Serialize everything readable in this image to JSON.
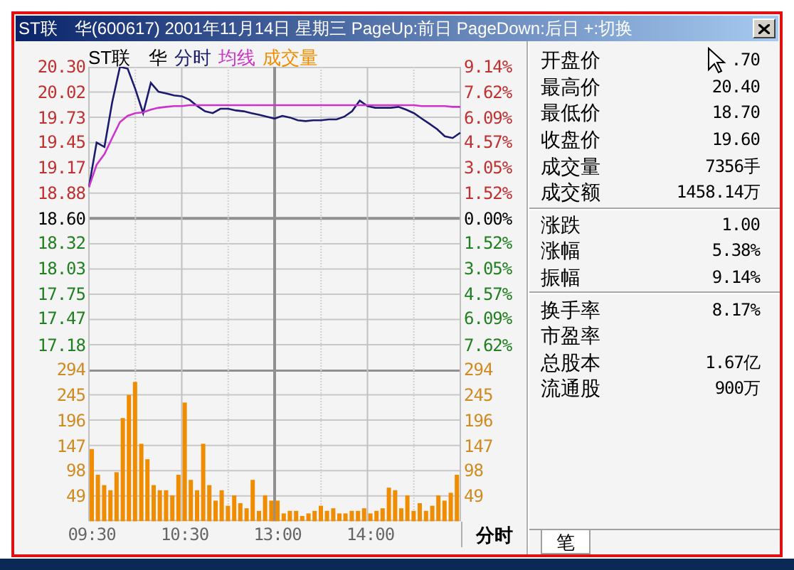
{
  "window": {
    "title": "ST联　华(600617) 2001年11月14日 星期三 PageUp:前日 PageDown:后日 +:切换"
  },
  "stock_name": "ST联　华",
  "price_chart": {
    "chart_data": {
      "type": "line",
      "categories": [
        null,
        null,
        null,
        null,
        null,
        null,
        null,
        null,
        null,
        null,
        null,
        null,
        null,
        null,
        null,
        null,
        null,
        null,
        null,
        null,
        null,
        null,
        null,
        null,
        null,
        null,
        null,
        null,
        null,
        null,
        null,
        null,
        null,
        null,
        null,
        null,
        null,
        null,
        null,
        null,
        null,
        null,
        null,
        null,
        null,
        null,
        null,
        null,
        null
      ],
      "series": [
        {
          "name": "分时",
          "color": "#1a1a6e",
          "values": [
            18.95,
            19.45,
            19.4,
            19.9,
            20.3,
            20.28,
            20.05,
            19.78,
            20.12,
            20.02,
            20.0,
            19.98,
            19.97,
            19.93,
            19.86,
            19.8,
            19.78,
            19.83,
            19.83,
            19.81,
            19.8,
            19.78,
            19.76,
            19.74,
            19.72,
            19.75,
            19.73,
            19.7,
            19.69,
            19.7,
            19.7,
            19.71,
            19.71,
            19.74,
            19.8,
            19.92,
            19.86,
            19.84,
            19.84,
            19.84,
            19.85,
            19.82,
            19.78,
            19.72,
            19.66,
            19.6,
            19.52,
            19.5,
            19.56
          ]
        },
        {
          "name": "均线",
          "color": "#cc33cc",
          "values": [
            18.95,
            19.2,
            19.32,
            19.5,
            19.68,
            19.75,
            19.78,
            19.79,
            19.82,
            19.84,
            19.85,
            19.86,
            19.86,
            19.87,
            19.87,
            19.87,
            19.87,
            19.87,
            19.87,
            19.87,
            19.87,
            19.87,
            19.87,
            19.87,
            19.87,
            19.87,
            19.87,
            19.87,
            19.87,
            19.87,
            19.87,
            19.87,
            19.87,
            19.87,
            19.87,
            19.87,
            19.87,
            19.87,
            19.87,
            19.87,
            19.87,
            19.87,
            19.87,
            19.86,
            19.86,
            19.86,
            19.86,
            19.85,
            19.85
          ]
        }
      ],
      "ylim": [
        17.18,
        20.3
      ],
      "grid": true,
      "yticks": [
        {
          "value": 20.3,
          "label": "20.30"
        },
        {
          "value": 20.02,
          "label": "20.02"
        },
        {
          "value": 19.73,
          "label": "19.73"
        },
        {
          "value": 19.45,
          "label": "19.45"
        },
        {
          "value": 19.17,
          "label": "19.17"
        },
        {
          "value": 18.88,
          "label": "18.88"
        },
        {
          "value": 18.6,
          "label": "18.60"
        },
        {
          "value": 18.32,
          "label": "18.32"
        },
        {
          "value": 18.03,
          "label": "18.03"
        },
        {
          "value": 17.75,
          "label": "17.75"
        },
        {
          "value": 17.47,
          "label": "17.47"
        },
        {
          "value": 17.18,
          "label": "17.18"
        }
      ]
    },
    "right_axis": [
      {
        "label": "9.14%",
        "kind": "up"
      },
      {
        "label": "7.62%",
        "kind": "up"
      },
      {
        "label": "6.09%",
        "kind": "up"
      },
      {
        "label": "4.57%",
        "kind": "up"
      },
      {
        "label": "3.05%",
        "kind": "up"
      },
      {
        "label": "1.52%",
        "kind": "up"
      },
      {
        "label": "0.00%",
        "kind": "flat"
      },
      {
        "label": "1.52%",
        "kind": "down"
      },
      {
        "label": "3.05%",
        "kind": "down"
      },
      {
        "label": "4.57%",
        "kind": "down"
      },
      {
        "label": "6.09%",
        "kind": "down"
      },
      {
        "label": "7.62%",
        "kind": "down"
      }
    ]
  },
  "volume_chart": {
    "chart_data": {
      "type": "bar",
      "categories": [
        "09:30",
        null,
        null,
        null,
        null,
        null,
        null,
        null,
        null,
        null,
        null,
        null,
        null,
        null,
        null,
        "10:30",
        null,
        null,
        null,
        null,
        null,
        null,
        null,
        null,
        null,
        null,
        null,
        null,
        null,
        null,
        "13:00",
        null,
        null,
        null,
        null,
        null,
        null,
        null,
        null,
        null,
        null,
        null,
        null,
        null,
        null,
        "14:00",
        null,
        null,
        null,
        null,
        null,
        null,
        null,
        null,
        null,
        null,
        null,
        null,
        null,
        null
      ],
      "series": [
        {
          "name": "成交量",
          "color": "#f08c00",
          "values": [
            140,
            90,
            70,
            60,
            95,
            200,
            245,
            270,
            150,
            120,
            70,
            60,
            60,
            50,
            90,
            230,
            80,
            60,
            150,
            70,
            40,
            60,
            30,
            50,
            35,
            25,
            80,
            20,
            50,
            40,
            40,
            15,
            20,
            20,
            10,
            15,
            20,
            30,
            20,
            25,
            15,
            15,
            20,
            20,
            25,
            15,
            20,
            25,
            65,
            60,
            25,
            50,
            20,
            35,
            20,
            30,
            50,
            40,
            55,
            90
          ]
        }
      ],
      "ylim": [
        0,
        294
      ],
      "grid": true,
      "yticks": [
        {
          "value": 294,
          "label": "294"
        },
        {
          "value": 245,
          "label": "245"
        },
        {
          "value": 196,
          "label": "196"
        },
        {
          "value": 147,
          "label": "147"
        },
        {
          "value": 98,
          "label": "98"
        },
        {
          "value": 49,
          "label": "49"
        }
      ]
    },
    "right_axis": [
      "294",
      "245",
      "196",
      "147",
      "98",
      "49"
    ]
  },
  "period_tab": "分时",
  "info_panel": {
    "sections": [
      [
        {
          "label": "开盘价",
          "value": ".70"
        },
        {
          "label": "最高价",
          "value": "20.40"
        },
        {
          "label": "最低价",
          "value": "18.70"
        },
        {
          "label": "收盘价",
          "value": "19.60"
        },
        {
          "label": "成交量",
          "value": "7356手"
        },
        {
          "label": "成交额",
          "value": "1458.14万"
        }
      ],
      [
        {
          "label": "涨跌",
          "value": "1.00"
        },
        {
          "label": "涨幅",
          "value": "5.38%"
        },
        {
          "label": "振幅",
          "value": "9.14%"
        }
      ],
      [
        {
          "label": "换手率",
          "value": "8.17%"
        },
        {
          "label": "市盈率"
        },
        {
          "label": "总股本",
          "value": "1.67亿"
        },
        {
          "label": "流通股",
          "value": "900万"
        }
      ]
    ],
    "tabs": [
      {
        "label": "笔"
      }
    ]
  }
}
